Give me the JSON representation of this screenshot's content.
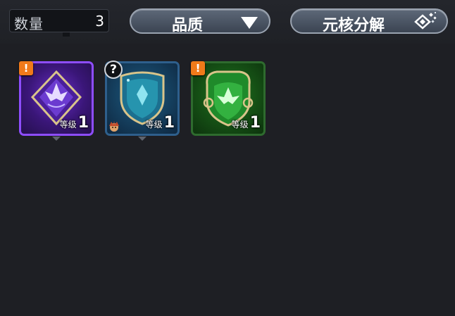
{
  "header": {
    "count_label": "数量",
    "count_value": "3",
    "quality_label": "品质",
    "decompose_label": "元核分解"
  },
  "cores": [
    {
      "rarity": "purple",
      "level_label": "等级",
      "level": "1",
      "badge": "!"
    },
    {
      "rarity": "blue",
      "level_label": "等级",
      "level": "1",
      "badge": "?"
    },
    {
      "rarity": "green",
      "level_label": "等级",
      "level": "1",
      "badge": "!"
    }
  ],
  "colors": {
    "purple": "#8e4dff",
    "blue": "#2e5f8c",
    "green": "#2e6b2e",
    "alert": "#f07a1a",
    "background": "#1e1f24"
  },
  "icons": {
    "quality_dropdown": "triangle-down-icon",
    "decompose": "diamond-decompose-icon",
    "alert": "exclamation-badge-icon",
    "unknown": "question-badge-icon",
    "equipped_by": "character-avatar-icon"
  }
}
